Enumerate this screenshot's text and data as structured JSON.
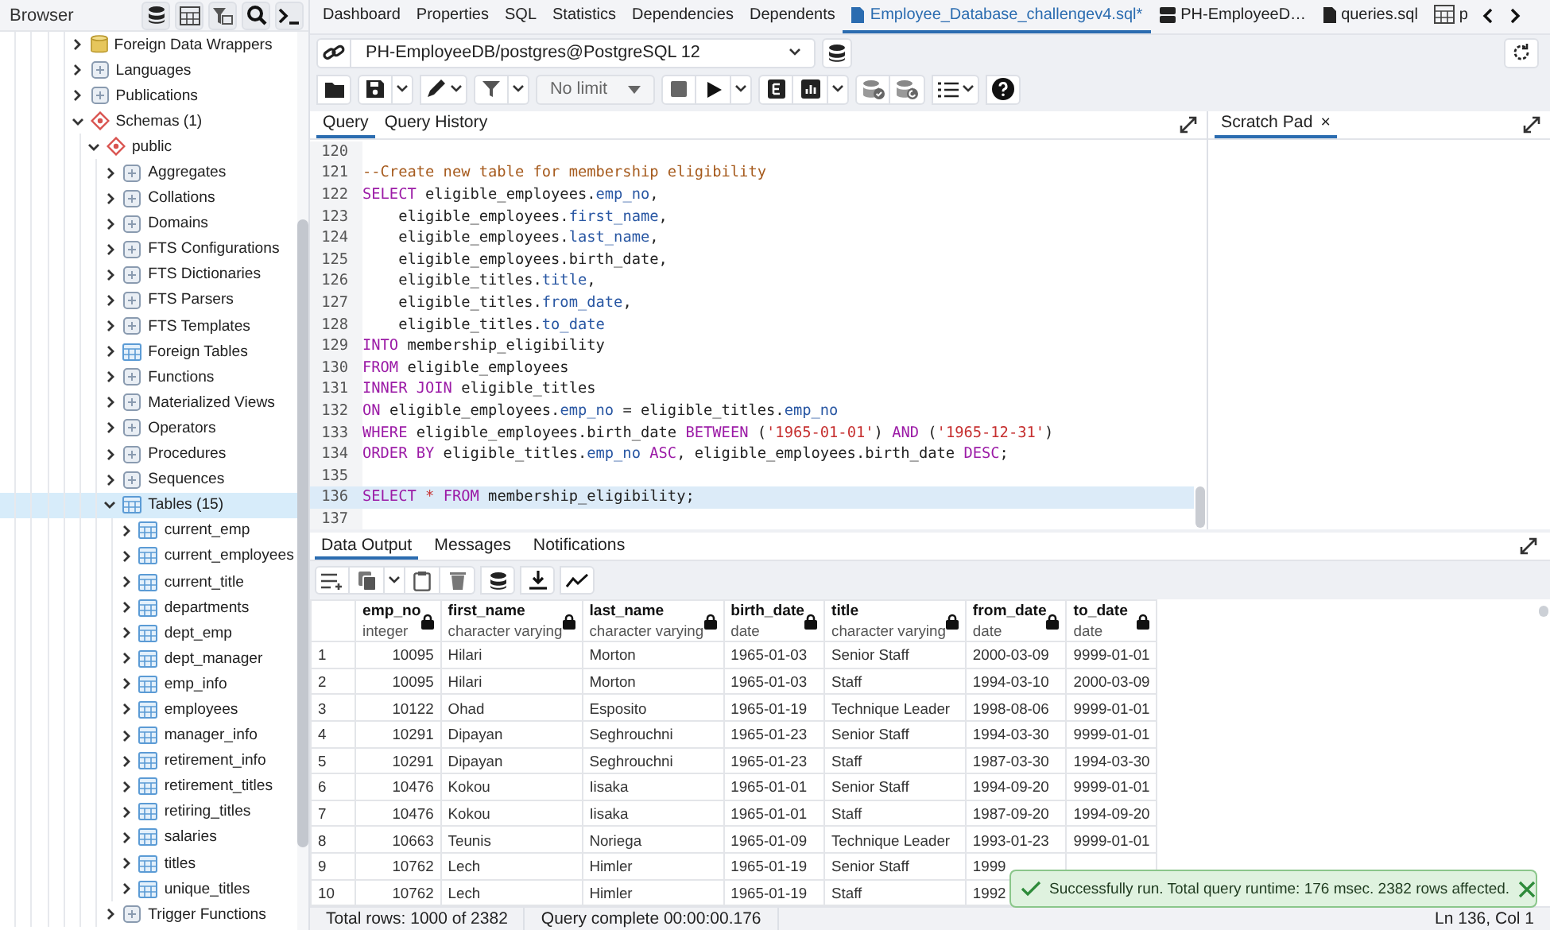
{
  "browser": {
    "title": "Browser",
    "tree": [
      {
        "label": "Foreign Data Wrappers",
        "kind": "storage",
        "expanded": false,
        "selected": false
      },
      {
        "label": "Languages",
        "kind": "object",
        "expanded": false,
        "selected": false
      },
      {
        "label": "Publications",
        "kind": "object",
        "expanded": false,
        "selected": false
      },
      {
        "label": "Schemas (1)",
        "kind": "schema",
        "expanded": true,
        "selected": false,
        "children": [
          {
            "label": "public",
            "kind": "schema",
            "expanded": true,
            "selected": false,
            "children": [
              {
                "label": "Aggregates",
                "kind": "object",
                "expanded": false,
                "selected": false
              },
              {
                "label": "Collations",
                "kind": "object",
                "expanded": false,
                "selected": false
              },
              {
                "label": "Domains",
                "kind": "object",
                "expanded": false,
                "selected": false
              },
              {
                "label": "FTS Configurations",
                "kind": "object",
                "expanded": false,
                "selected": false
              },
              {
                "label": "FTS Dictionaries",
                "kind": "object",
                "expanded": false,
                "selected": false
              },
              {
                "label": "FTS Parsers",
                "kind": "object",
                "expanded": false,
                "selected": false
              },
              {
                "label": "FTS Templates",
                "kind": "object",
                "expanded": false,
                "selected": false
              },
              {
                "label": "Foreign Tables",
                "kind": "table",
                "expanded": false,
                "selected": false
              },
              {
                "label": "Functions",
                "kind": "object",
                "expanded": false,
                "selected": false
              },
              {
                "label": "Materialized Views",
                "kind": "object",
                "expanded": false,
                "selected": false
              },
              {
                "label": "Operators",
                "kind": "object",
                "expanded": false,
                "selected": false
              },
              {
                "label": "Procedures",
                "kind": "object",
                "expanded": false,
                "selected": false
              },
              {
                "label": "Sequences",
                "kind": "object",
                "expanded": false,
                "selected": false
              },
              {
                "label": "Tables (15)",
                "kind": "table",
                "expanded": true,
                "selected": true,
                "children": [
                  {
                    "label": "current_emp",
                    "kind": "table",
                    "expanded": false,
                    "selected": false
                  },
                  {
                    "label": "current_employees",
                    "kind": "table",
                    "expanded": false,
                    "selected": false
                  },
                  {
                    "label": "current_title",
                    "kind": "table",
                    "expanded": false,
                    "selected": false
                  },
                  {
                    "label": "departments",
                    "kind": "table",
                    "expanded": false,
                    "selected": false
                  },
                  {
                    "label": "dept_emp",
                    "kind": "table",
                    "expanded": false,
                    "selected": false
                  },
                  {
                    "label": "dept_manager",
                    "kind": "table",
                    "expanded": false,
                    "selected": false
                  },
                  {
                    "label": "emp_info",
                    "kind": "table",
                    "expanded": false,
                    "selected": false
                  },
                  {
                    "label": "employees",
                    "kind": "table",
                    "expanded": false,
                    "selected": false
                  },
                  {
                    "label": "manager_info",
                    "kind": "table",
                    "expanded": false,
                    "selected": false
                  },
                  {
                    "label": "retirement_info",
                    "kind": "table",
                    "expanded": false,
                    "selected": false
                  },
                  {
                    "label": "retirement_titles",
                    "kind": "table",
                    "expanded": false,
                    "selected": false
                  },
                  {
                    "label": "retiring_titles",
                    "kind": "table",
                    "expanded": false,
                    "selected": false
                  },
                  {
                    "label": "salaries",
                    "kind": "table",
                    "expanded": false,
                    "selected": false
                  },
                  {
                    "label": "titles",
                    "kind": "table",
                    "expanded": false,
                    "selected": false
                  },
                  {
                    "label": "unique_titles",
                    "kind": "table",
                    "expanded": false,
                    "selected": false
                  }
                ]
              },
              {
                "label": "Trigger Functions",
                "kind": "object",
                "expanded": false,
                "selected": false
              }
            ]
          }
        ]
      }
    ]
  },
  "tabs": [
    {
      "label": "Dashboard",
      "kind": "plain",
      "selected": false
    },
    {
      "label": "Properties",
      "kind": "plain",
      "selected": false
    },
    {
      "label": "SQL",
      "kind": "plain",
      "selected": false
    },
    {
      "label": "Statistics",
      "kind": "plain",
      "selected": false
    },
    {
      "label": "Dependencies",
      "kind": "plain",
      "selected": false
    },
    {
      "label": "Dependents",
      "kind": "plain",
      "selected": false
    },
    {
      "label": "Employee_Database_challengev4.sql*",
      "kind": "file",
      "selected": true
    },
    {
      "label": "PH-EmployeeD…",
      "kind": "server",
      "selected": false
    },
    {
      "label": "queries.sql",
      "kind": "file",
      "selected": false
    },
    {
      "label": "p",
      "kind": "table",
      "selected": false
    }
  ],
  "connection": {
    "value": "PH-EmployeeDB/postgres@PostgreSQL 12"
  },
  "toolbar": {
    "limit": "No limit"
  },
  "query_tabs": [
    {
      "label": "Query",
      "selected": true
    },
    {
      "label": "Query History",
      "selected": false
    }
  ],
  "scratch_pad": {
    "label": "Scratch Pad",
    "close": "×"
  },
  "editor": {
    "lines": [
      {
        "number": "120",
        "selected": false
      },
      {
        "number": "121",
        "selected": false,
        "tokens": [
          {
            "text": "--Create new table for membership eligibility",
            "kind": "comment"
          }
        ]
      },
      {
        "number": "122",
        "selected": false,
        "tokens": [
          {
            "text": "SELECT",
            "kind": "kw"
          },
          {
            "text": " eligible_employees.",
            "kind": "plain"
          },
          {
            "text": "emp_no",
            "kind": "col"
          },
          {
            "text": ",",
            "kind": "plain"
          }
        ]
      },
      {
        "number": "123",
        "selected": false,
        "tokens": [
          {
            "text": "    eligible_employees.",
            "kind": "plain"
          },
          {
            "text": "first_name",
            "kind": "col"
          },
          {
            "text": ",",
            "kind": "plain"
          }
        ]
      },
      {
        "number": "124",
        "selected": false,
        "tokens": [
          {
            "text": "    eligible_employees.",
            "kind": "plain"
          },
          {
            "text": "last_name",
            "kind": "col"
          },
          {
            "text": ",",
            "kind": "plain"
          }
        ]
      },
      {
        "number": "125",
        "selected": false,
        "tokens": [
          {
            "text": "    eligible_employees.birth_date,",
            "kind": "plain"
          }
        ]
      },
      {
        "number": "126",
        "selected": false,
        "tokens": [
          {
            "text": "    eligible_titles.",
            "kind": "plain"
          },
          {
            "text": "title",
            "kind": "col"
          },
          {
            "text": ",",
            "kind": "plain"
          }
        ]
      },
      {
        "number": "127",
        "selected": false,
        "tokens": [
          {
            "text": "    eligible_titles.",
            "kind": "plain"
          },
          {
            "text": "from_date",
            "kind": "col"
          },
          {
            "text": ",",
            "kind": "plain"
          }
        ]
      },
      {
        "number": "128",
        "selected": false,
        "tokens": [
          {
            "text": "    eligible_titles.",
            "kind": "plain"
          },
          {
            "text": "to_date",
            "kind": "col"
          }
        ]
      },
      {
        "number": "129",
        "selected": false,
        "tokens": [
          {
            "text": "INTO",
            "kind": "kw"
          },
          {
            "text": " membership_eligibility",
            "kind": "plain"
          }
        ]
      },
      {
        "number": "130",
        "selected": false,
        "tokens": [
          {
            "text": "FROM",
            "kind": "kw"
          },
          {
            "text": " eligible_employees",
            "kind": "plain"
          }
        ]
      },
      {
        "number": "131",
        "selected": false,
        "tokens": [
          {
            "text": "INNER JOIN",
            "kind": "kw"
          },
          {
            "text": " eligible_titles",
            "kind": "plain"
          }
        ]
      },
      {
        "number": "132",
        "selected": false,
        "tokens": [
          {
            "text": "ON",
            "kind": "kw"
          },
          {
            "text": " eligible_employees.",
            "kind": "plain"
          },
          {
            "text": "emp_no",
            "kind": "col"
          },
          {
            "text": " = eligible_titles.",
            "kind": "plain"
          },
          {
            "text": "emp_no",
            "kind": "col"
          }
        ]
      },
      {
        "number": "133",
        "selected": false,
        "tokens": [
          {
            "text": "WHERE",
            "kind": "kw"
          },
          {
            "text": " eligible_employees.birth_date ",
            "kind": "plain"
          },
          {
            "text": "BETWEEN",
            "kind": "kw"
          },
          {
            "text": " (",
            "kind": "plain"
          },
          {
            "text": "'1965-01-01'",
            "kind": "str"
          },
          {
            "text": ") ",
            "kind": "plain"
          },
          {
            "text": "AND",
            "kind": "kw"
          },
          {
            "text": " (",
            "kind": "plain"
          },
          {
            "text": "'1965-12-31'",
            "kind": "str"
          },
          {
            "text": ")",
            "kind": "plain"
          }
        ]
      },
      {
        "number": "134",
        "selected": false,
        "tokens": [
          {
            "text": "ORDER BY",
            "kind": "kw"
          },
          {
            "text": " eligible_titles.",
            "kind": "plain"
          },
          {
            "text": "emp_no",
            "kind": "col"
          },
          {
            "text": " ASC",
            "kind": "kw"
          },
          {
            "text": ", eligible_employees.birth_date ",
            "kind": "plain"
          },
          {
            "text": "DESC",
            "kind": "kw"
          },
          {
            "text": ";",
            "kind": "plain"
          }
        ]
      },
      {
        "number": "135",
        "selected": false
      },
      {
        "number": "136",
        "selected": true,
        "tokens": [
          {
            "text": "SELECT",
            "kind": "kw"
          },
          {
            "text": " *",
            "kind": "op"
          },
          {
            "text": " FROM",
            "kind": "kw"
          },
          {
            "text": " membership_eligibility;",
            "kind": "plain"
          }
        ]
      },
      {
        "number": "137",
        "selected": false
      }
    ]
  },
  "output_tabs": [
    {
      "label": "Data Output",
      "selected": true
    },
    {
      "label": "Messages",
      "selected": false
    },
    {
      "label": "Notifications",
      "selected": false
    }
  ],
  "grid": {
    "columns": [
      {
        "name": "emp_no",
        "type": "integer"
      },
      {
        "name": "first_name",
        "type": "character varying"
      },
      {
        "name": "last_name",
        "type": "character varying"
      },
      {
        "name": "birth_date",
        "type": "date"
      },
      {
        "name": "title",
        "type": "character varying"
      },
      {
        "name": "from_date",
        "type": "date"
      },
      {
        "name": "to_date",
        "type": "date"
      }
    ],
    "rows": [
      {
        "number": "1",
        "cells": [
          "10095",
          "Hilari",
          "Morton",
          "1965-01-03",
          "Senior Staff",
          "2000-03-09",
          "9999-01-01"
        ]
      },
      {
        "number": "2",
        "cells": [
          "10095",
          "Hilari",
          "Morton",
          "1965-01-03",
          "Staff",
          "1994-03-10",
          "2000-03-09"
        ]
      },
      {
        "number": "3",
        "cells": [
          "10122",
          "Ohad",
          "Esposito",
          "1965-01-19",
          "Technique Leader",
          "1998-08-06",
          "9999-01-01"
        ]
      },
      {
        "number": "4",
        "cells": [
          "10291",
          "Dipayan",
          "Seghrouchni",
          "1965-01-23",
          "Senior Staff",
          "1994-03-30",
          "9999-01-01"
        ]
      },
      {
        "number": "5",
        "cells": [
          "10291",
          "Dipayan",
          "Seghrouchni",
          "1965-01-23",
          "Staff",
          "1987-03-30",
          "1994-03-30"
        ]
      },
      {
        "number": "6",
        "cells": [
          "10476",
          "Kokou",
          "Iisaka",
          "1965-01-01",
          "Senior Staff",
          "1994-09-20",
          "9999-01-01"
        ]
      },
      {
        "number": "7",
        "cells": [
          "10476",
          "Kokou",
          "Iisaka",
          "1965-01-01",
          "Staff",
          "1987-09-20",
          "1994-09-20"
        ]
      },
      {
        "number": "8",
        "cells": [
          "10663",
          "Teunis",
          "Noriega",
          "1965-01-09",
          "Technique Leader",
          "1993-01-23",
          "9999-01-01"
        ]
      },
      {
        "number": "9",
        "cells": [
          "10762",
          "Lech",
          "Himler",
          "1965-01-19",
          "Senior Staff",
          "1999",
          null
        ]
      },
      {
        "number": "10",
        "cells": [
          "10762",
          "Lech",
          "Himler",
          "1965-01-19",
          "Staff",
          "1992",
          null
        ]
      }
    ]
  },
  "toast": {
    "message": "Successfully run. Total query runtime: 176 msec. 2382 rows affected."
  },
  "status": {
    "rows": "Total rows: 1000 of 2382",
    "query": "Query complete 00:00:00.176",
    "cursor": "Ln 136, Col 1"
  }
}
